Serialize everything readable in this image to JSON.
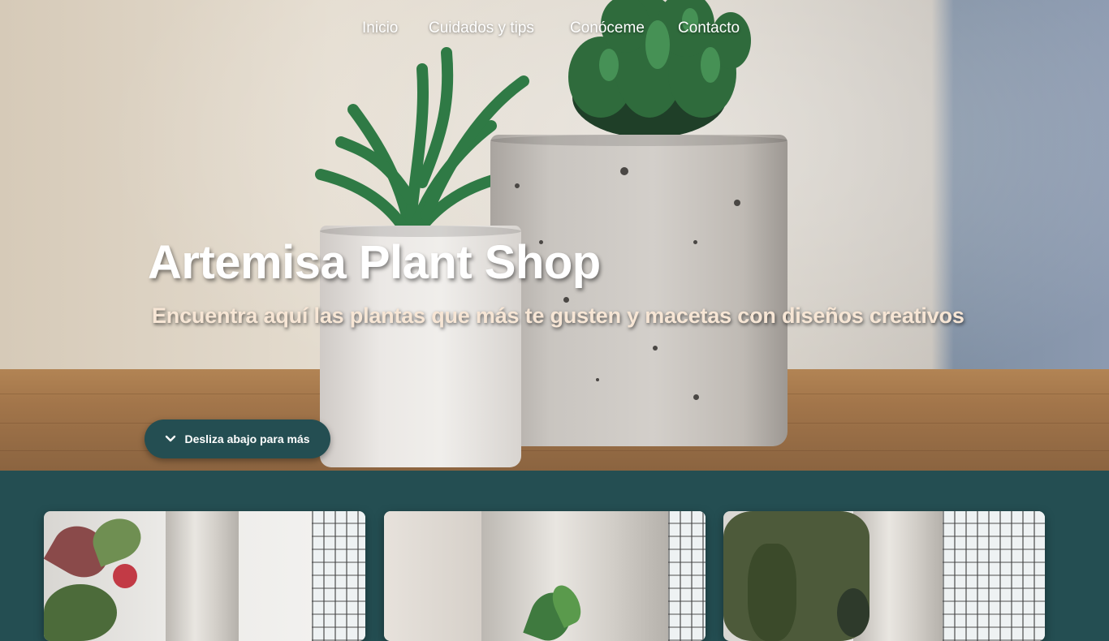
{
  "nav": {
    "items": [
      {
        "label": "Inicio"
      },
      {
        "label": "Cuidados y tips"
      },
      {
        "label": "Conóceme"
      },
      {
        "label": "Contacto"
      }
    ]
  },
  "hero": {
    "title": "Artemisa Plant Shop",
    "subtitle": "Encuentra aquí las plantas que más te gusten y macetas con diseños creativos",
    "scroll_button": {
      "label": "Desliza abajo para más",
      "icon": "chevron-down-icon"
    }
  },
  "colors": {
    "accent": "#244e52",
    "nav_text": "#ffffff",
    "subtitle_text": "#f7e6d5"
  },
  "gallery": {
    "cards": [
      {
        "image": "plant-photo-1"
      },
      {
        "image": "plant-photo-2"
      },
      {
        "image": "plant-photo-3"
      }
    ]
  }
}
